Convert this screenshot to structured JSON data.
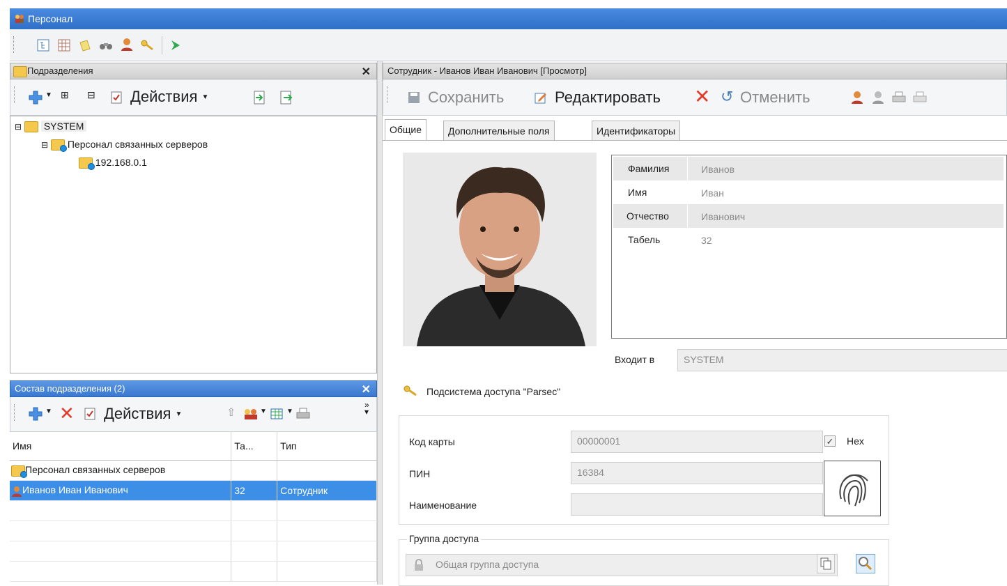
{
  "window": {
    "title": "Персонал"
  },
  "main_toolbar": {
    "icons": [
      "tree-view-icon",
      "grid-view-icon",
      "notes-icon",
      "binoculars-icon",
      "person-icon",
      "key-icon",
      "run-icon"
    ]
  },
  "departments": {
    "header": "Подразделения",
    "actions_label": "Действия",
    "tree": [
      {
        "label": "SYSTEM",
        "level": 0
      },
      {
        "label": "Персонал связанных серверов",
        "level": 1
      },
      {
        "label": "192.168.0.1",
        "level": 2
      }
    ]
  },
  "members": {
    "header": "Состав подразделения (2)",
    "actions_label": "Действия",
    "columns": [
      "Имя",
      "Та...",
      "Тип"
    ],
    "rows": [
      {
        "name": "Персонал связанных серверов",
        "tab": "",
        "type": ""
      },
      {
        "name": "Иванов Иван Иванович",
        "tab": "32",
        "type": "Сотрудник"
      }
    ]
  },
  "employee": {
    "header": "Сотрудник - Иванов Иван Иванович [Просмотр]",
    "toolbar": {
      "save": "Сохранить",
      "edit": "Редактировать",
      "cancel": "Отменить"
    },
    "tabs": [
      "Общие",
      "Дополнительные поля",
      "Идентификаторы"
    ],
    "fields": [
      {
        "label": "Фамилия",
        "value": "Иванов"
      },
      {
        "label": "Имя",
        "value": "Иван"
      },
      {
        "label": "Отчество",
        "value": "Иванович"
      },
      {
        "label": "Табель",
        "value": "32"
      }
    ],
    "member_of_label": "Входит в",
    "member_of_value": "SYSTEM",
    "access_subsystem": "Подсистема доступа \"Parsec\"",
    "card_code_label": "Код карты",
    "card_code_value": "00000001",
    "hex_label": "Hex",
    "pin_label": "ПИН",
    "pin_value": "16384",
    "name_label": "Наименование",
    "name_value": "",
    "access_group_label": "Группа доступа",
    "access_group_value": "Общая группа доступа"
  }
}
